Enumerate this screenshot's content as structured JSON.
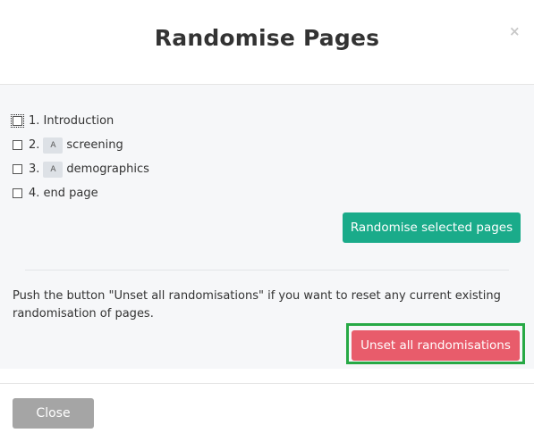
{
  "dialog": {
    "title": "Randomise Pages",
    "close_glyph": "×"
  },
  "pages": [
    {
      "number": "1.",
      "badge": "",
      "name": "Introduction",
      "checked": false,
      "focused": true
    },
    {
      "number": "2.",
      "badge": "A",
      "name": "screening",
      "checked": false,
      "focused": false
    },
    {
      "number": "3.",
      "badge": "A",
      "name": "demographics",
      "checked": false,
      "focused": false
    },
    {
      "number": "4.",
      "badge": "",
      "name": "end page",
      "checked": false,
      "focused": false
    }
  ],
  "buttons": {
    "randomise_label": "Randomise selected pages",
    "unset_label": "Unset all randomisations",
    "close_label": "Close"
  },
  "note": "Push the button \"Unset all randomisations\" if you want to reset any current existing randomisation of pages.",
  "colors": {
    "randomise": "#1aab8a",
    "unset": "#e85c6b",
    "close": "#a5a5a5",
    "highlight": "#27a945"
  },
  "icons": {
    "close": "close-icon",
    "checkbox": "checkbox-icon"
  }
}
